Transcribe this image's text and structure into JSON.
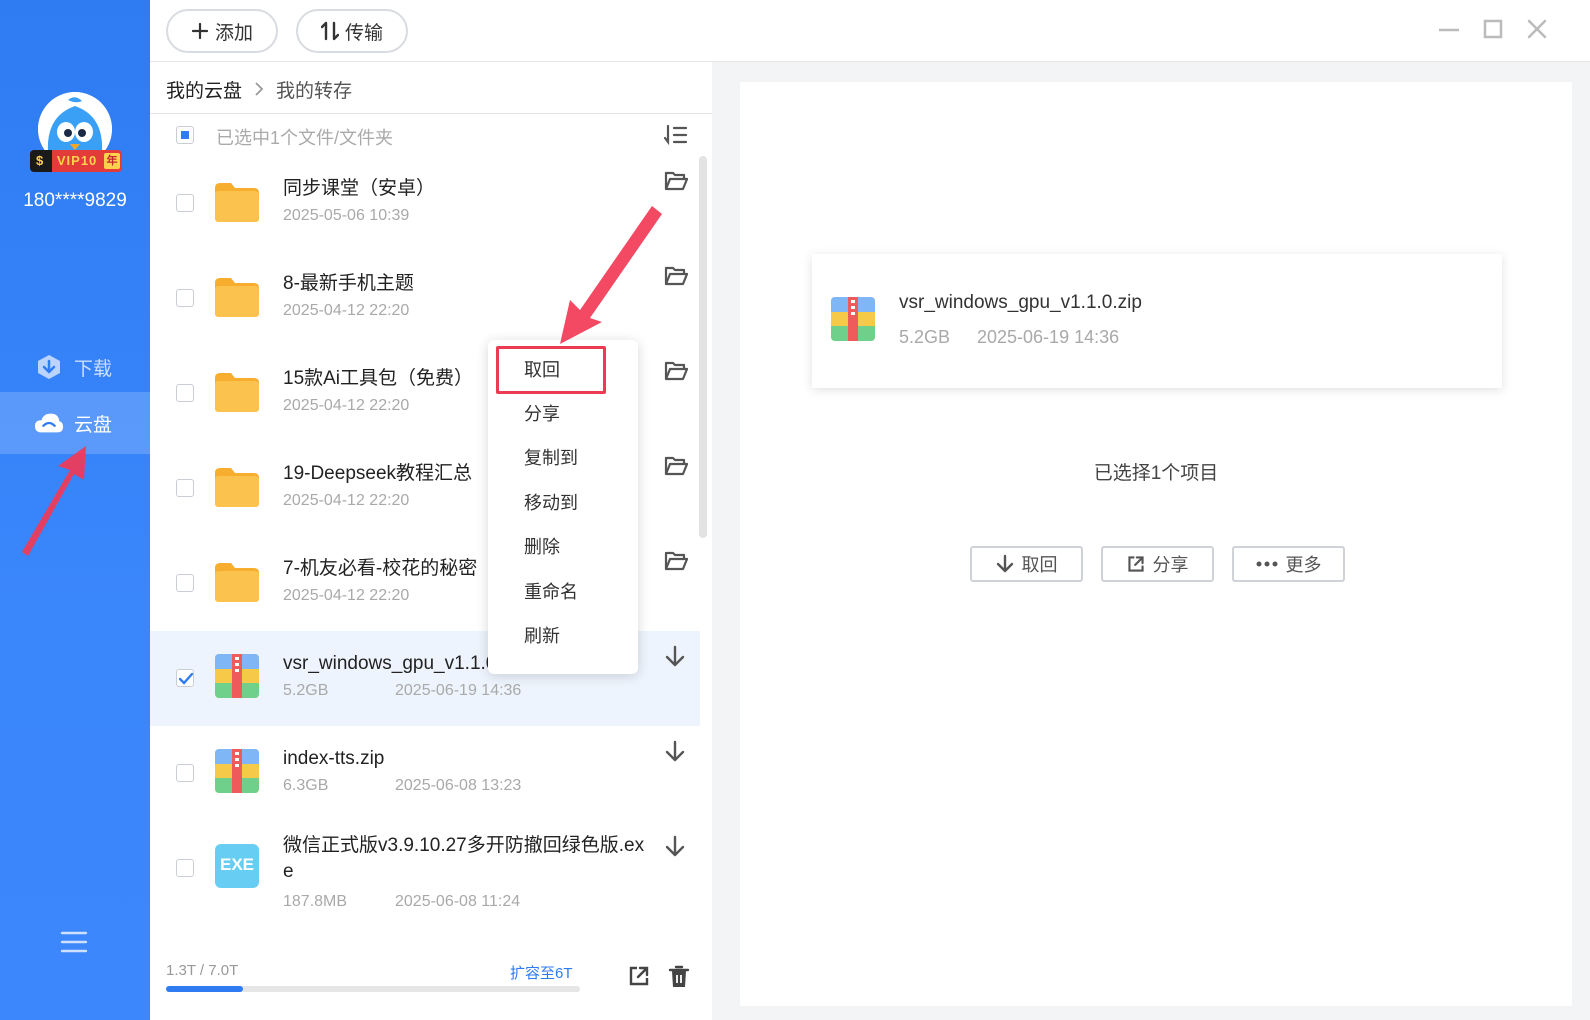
{
  "user": {
    "phone": "180****9829",
    "vip_label": "VIP10",
    "vip_year": "年"
  },
  "nav": [
    {
      "label": "下载",
      "icon": "download-shield-icon"
    },
    {
      "label": "云盘",
      "icon": "cloud-icon"
    }
  ],
  "toolbar": {
    "add_label": "添加",
    "transfer_label": "传输"
  },
  "breadcrumb": {
    "root": "我的云盘",
    "current": "我的转存"
  },
  "selection_info": "已选中1个文件/文件夹",
  "files": [
    {
      "name": "同步课堂（安卓）",
      "size": "",
      "date": "2025-05-06 10:39",
      "type": "folder"
    },
    {
      "name": "8-最新手机主题",
      "size": "",
      "date": "2025-04-12 22:20",
      "type": "folder"
    },
    {
      "name": "15款Ai工具包（免费）",
      "size": "",
      "date": "2025-04-12 22:20",
      "type": "folder"
    },
    {
      "name": "19-Deepseek教程汇总",
      "size": "",
      "date": "2025-04-12 22:20",
      "type": "folder"
    },
    {
      "name": "7-机友必看-校花的秘密",
      "size": "",
      "date": "2025-04-12 22:20",
      "type": "folder"
    },
    {
      "name": "vsr_windows_gpu_v1.1.0.zip",
      "size": "5.2GB",
      "date": "2025-06-19 14:36",
      "type": "zip",
      "selected": true
    },
    {
      "name": "index-tts.zip",
      "size": "6.3GB",
      "date": "2025-06-08 13:23",
      "type": "zip"
    },
    {
      "name": "微信正式版v3.9.10.27多开防撤回绿色版.exe",
      "size": "187.8MB",
      "date": "2025-06-08 11:24",
      "type": "exe",
      "exe_label": "EXE"
    }
  ],
  "storage": {
    "used_text": "1.3T / 7.0T",
    "fraction": 0.186,
    "expand_label": "扩容至6T"
  },
  "context_menu": [
    "取回",
    "分享",
    "复制到",
    "移动到",
    "删除",
    "重命名",
    "刷新"
  ],
  "detail": {
    "file_name": "vsr_windows_gpu_v1.1.0.zip",
    "file_size": "5.2GB",
    "file_date": "2025-06-19 14:36",
    "selected_count": "已选择1个项目",
    "actions": [
      "取回",
      "分享",
      "更多"
    ]
  },
  "colors": {
    "accent": "#2f7bf2",
    "highlight": "#ec3a52",
    "folder": "#fbb93f"
  }
}
